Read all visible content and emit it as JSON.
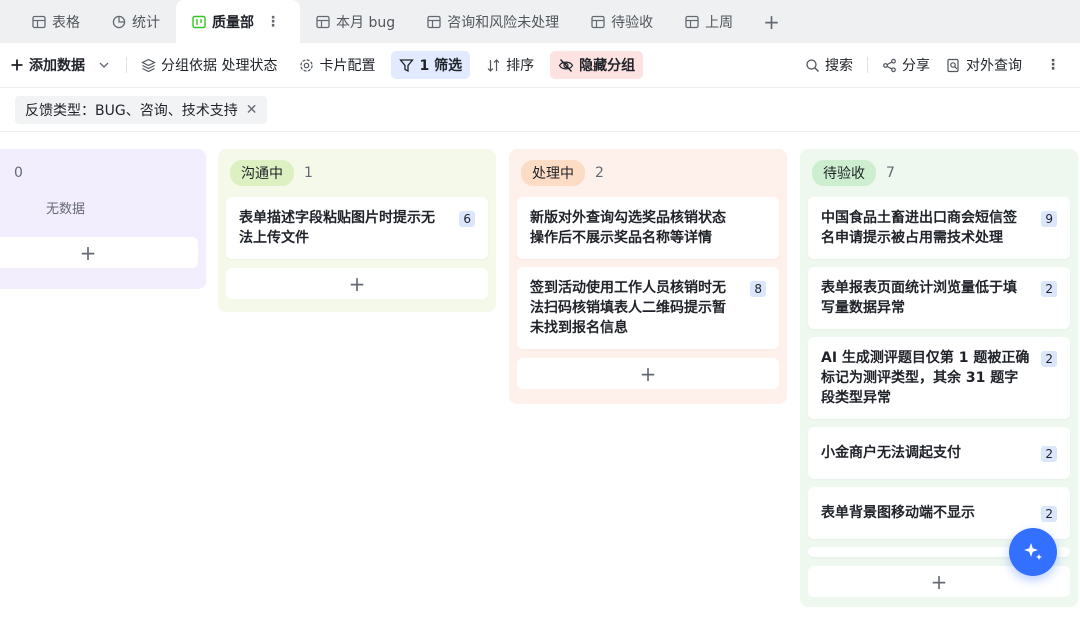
{
  "tabs": [
    {
      "label": "表格",
      "icon": "table-icon"
    },
    {
      "label": "统计",
      "icon": "pie-chart-icon"
    },
    {
      "label": "质量部",
      "icon": "kanban-icon",
      "active": true
    },
    {
      "label": "本月 bug",
      "icon": "table-icon"
    },
    {
      "label": "咨询和风险未处理",
      "icon": "table-icon"
    },
    {
      "label": "待验收",
      "icon": "table-icon"
    },
    {
      "label": "上周",
      "icon": "table-icon"
    }
  ],
  "tab_add_label": "+",
  "tab_more_label": "⋮",
  "toolbar": {
    "add_label": "添加数据",
    "group_label": "分组依据 处理状态",
    "card_config_label": "卡片配置",
    "filter_label": "1 筛选",
    "sort_label": "排序",
    "hide_group_label": "隐藏分组",
    "search_label": "搜索",
    "share_label": "分享",
    "external_query_label": "对外查询",
    "more_label": "⋮"
  },
  "filter": {
    "chip_label": "反馈类型：BUG、咨询、技术支持",
    "close_label": "✕"
  },
  "board": {
    "columns": [
      {
        "label": "",
        "count": "0",
        "empty_text": "无数据",
        "bg": "#f3eefe",
        "cards": []
      },
      {
        "label": "沟通中",
        "count": "1",
        "bg": "#f5f9ea",
        "pill": "#ddf0c2",
        "cards": [
          {
            "title": "表单描述字段粘贴图片时提示无法上传文件",
            "badge": "6"
          }
        ]
      },
      {
        "label": "处理中",
        "count": "2",
        "bg": "#fef1eb",
        "pill": "#fddcc6",
        "cards": [
          {
            "title": "新版对外查询勾选奖品核销状态操作后不展示奖品名称等详情",
            "badge": ""
          },
          {
            "title": "签到活动使用工作人员核销时无法扫码核销填表人二维码提示暂未找到报名信息",
            "badge": "8"
          }
        ]
      },
      {
        "label": "待验收",
        "count": "7",
        "bg": "#eef8ef",
        "pill": "#cdeecf",
        "cards": [
          {
            "title": "中国食品土畜进出口商会短信签名申请提示被占用需技术处理",
            "badge": "9"
          },
          {
            "title": "表单报表页面统计浏览量低于填写量数据异常",
            "badge": "2"
          },
          {
            "title": "AI 生成测评题目仅第 1 题被正确标记为测评类型，其余 31 题字段类型异常",
            "badge": "2"
          },
          {
            "title": "小金商户无法调起支付",
            "badge": "2"
          },
          {
            "title": "表单背景图移动端不显示",
            "badge": "2"
          }
        ]
      }
    ],
    "add_card_label": "+"
  },
  "colors": {
    "accent": "#3370ff",
    "filter_bg": "#e1eaff",
    "hide_bg": "#fde2e2"
  }
}
